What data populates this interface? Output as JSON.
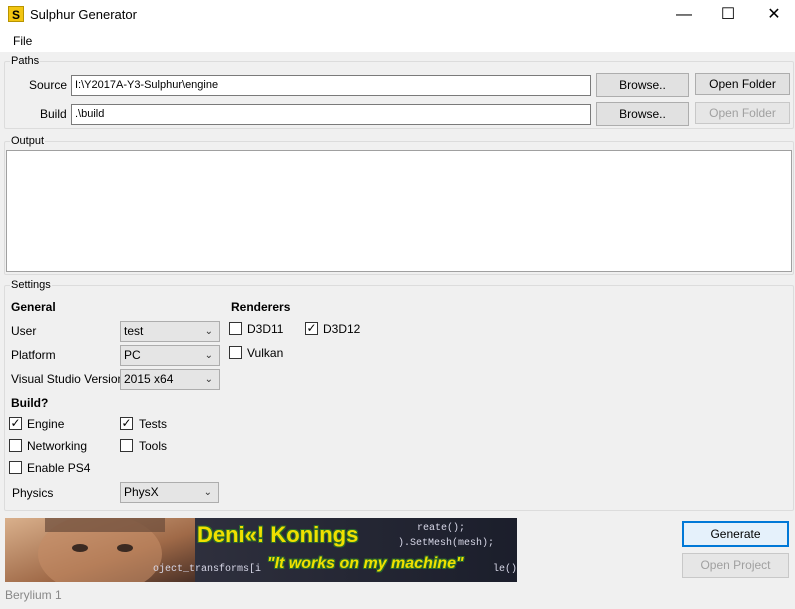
{
  "window": {
    "title": "Sulphur Generator",
    "icon_letter": "S",
    "minimize": "—",
    "maximize": "☐",
    "close": "✕"
  },
  "menu": {
    "file": "File"
  },
  "paths": {
    "group_label": "Paths",
    "source_label": "Source",
    "source_value": "I:\\Y2017A-Y3-Sulphur\\engine",
    "build_label": "Build",
    "build_value": ".\\build",
    "browse_label": "Browse..",
    "open_folder_label": "Open Folder"
  },
  "output": {
    "group_label": "Output"
  },
  "settings": {
    "group_label": "Settings",
    "general_heading": "General",
    "user_label": "User",
    "user_value": "test",
    "platform_label": "Platform",
    "platform_value": "PC",
    "vs_label": "Visual Studio Version",
    "vs_value": "2015 x64",
    "build_heading": "Build?",
    "engine_label": "Engine",
    "engine_checked": true,
    "tests_label": "Tests",
    "tests_checked": true,
    "networking_label": "Networking",
    "networking_checked": false,
    "tools_label": "Tools",
    "tools_checked": false,
    "ps4_label": "Enable PS4",
    "ps4_checked": false,
    "physics_label": "Physics",
    "physics_value": "PhysX",
    "renderers_heading": "Renderers",
    "d3d11_label": "D3D11",
    "d3d11_checked": false,
    "d3d12_label": "D3D12",
    "d3d12_checked": true,
    "vulkan_label": "Vulkan",
    "vulkan_checked": false
  },
  "banner": {
    "name": "Deni«! Konings",
    "tagline": "\"It works on my machine\"",
    "code_lines": [
      "reate();",
      ").SetMesh(mesh);",
      "oject_transforms[i",
      "le();"
    ]
  },
  "actions": {
    "generate": "Generate",
    "open_project": "Open Project"
  },
  "status": {
    "text": "Berylium 1"
  },
  "colors": {
    "accent": "#0078d7",
    "banner_text": "#f0e000",
    "banner_outline": "#2a6a2a"
  }
}
